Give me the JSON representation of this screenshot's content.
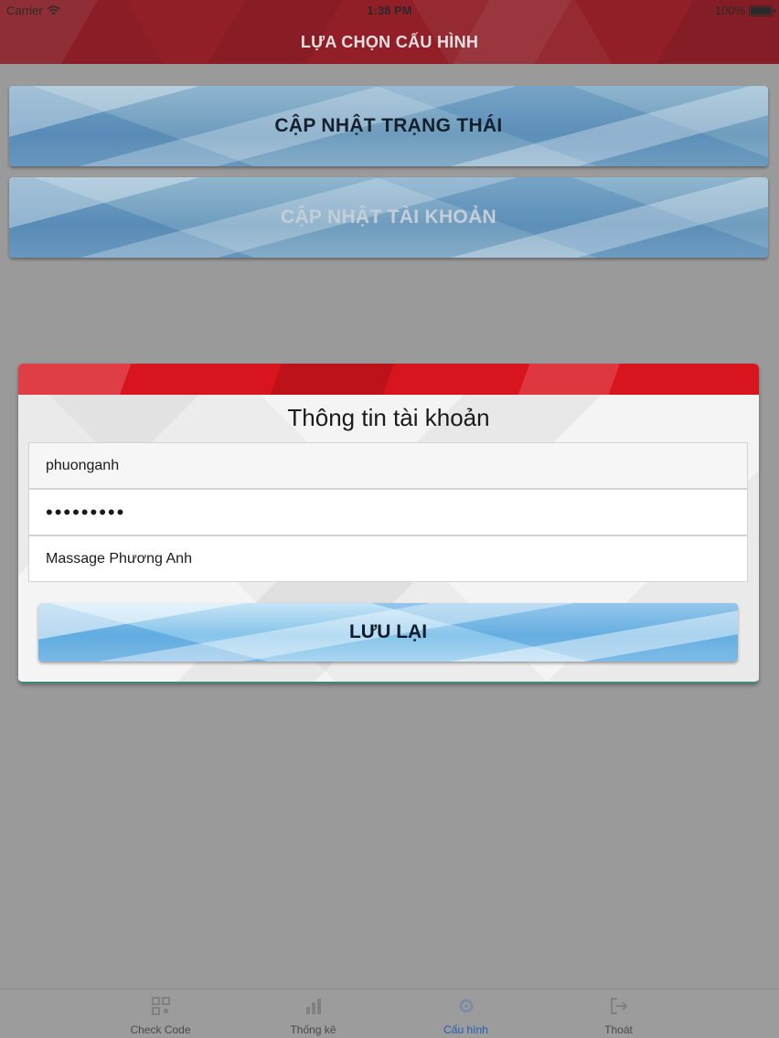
{
  "status_bar": {
    "carrier": "Carrier",
    "time": "1:38 PM",
    "battery": "100%"
  },
  "header": {
    "title": "LỰA CHỌN CẤU HÌNH"
  },
  "config": {
    "update_status_label": "CẬP NHẬT TRẠNG THÁI",
    "update_account_label": "CẬP NHẬT TÀI KHOẢN"
  },
  "modal": {
    "title": "Thông tin tài khoản",
    "username_value": "phuonganh",
    "password_value": "•••••••••",
    "display_name_value": "Massage Phương Anh",
    "save_label": "LƯU LẠI"
  },
  "tabs": [
    {
      "label": "Check Code",
      "icon": "qr-code-icon"
    },
    {
      "label": "Thống kê",
      "icon": "chart-icon"
    },
    {
      "label": "Cấu hình",
      "icon": "gear-icon",
      "active": true
    },
    {
      "label": "Thoát",
      "icon": "logout-icon"
    }
  ],
  "colors": {
    "header_red": "#b81220",
    "modal_red": "#d8141e",
    "button_blue": "#86c4ea",
    "active_tab": "#1d5fb8",
    "overlay_gray": "#9a9a9a"
  }
}
